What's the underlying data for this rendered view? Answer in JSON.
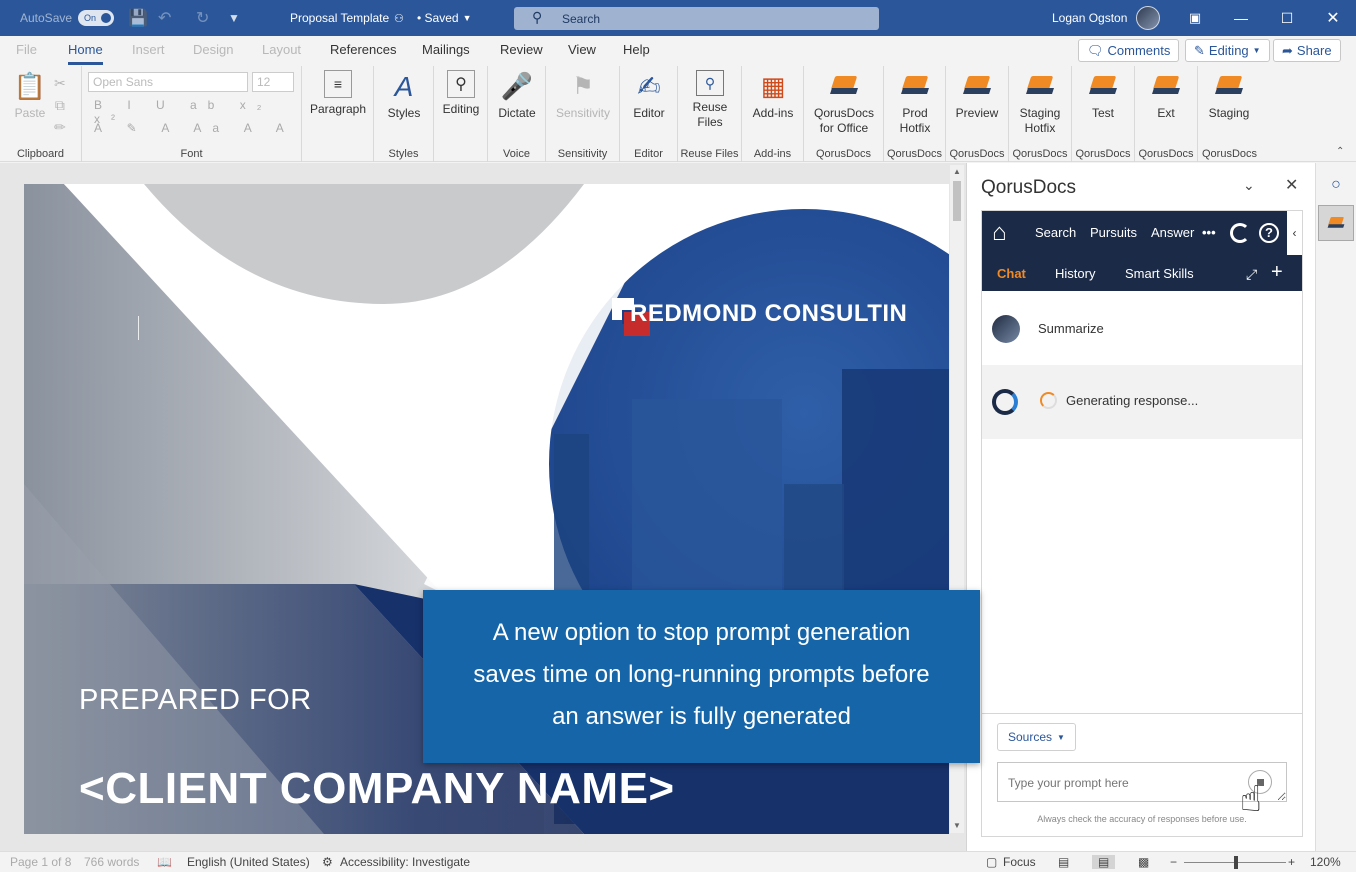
{
  "titlebar": {
    "autosave_label": "AutoSave",
    "autosave_state": "On",
    "doc_title": "Proposal Template",
    "saved_status": "• Saved",
    "search_placeholder": "Search",
    "user_name": "Logan Ogston"
  },
  "menu": {
    "tabs": [
      "File",
      "Home",
      "Insert",
      "Design",
      "Layout",
      "References",
      "Mailings",
      "Review",
      "View",
      "Help"
    ],
    "comments_label": "Comments",
    "editing_label": "Editing",
    "share_label": "Share"
  },
  "ribbon": {
    "clipboard_label": "Clipboard",
    "paste_label": "Paste",
    "font_name": "Open Sans",
    "font_size": "12",
    "font_group_label": "Font",
    "paragraph_label": "Paragraph",
    "styles_label": "Styles",
    "styles_group_label": "Styles",
    "editing_label": "Editing",
    "dictate_label": "Dictate",
    "voice_group_label": "Voice",
    "sensitivity_label": "Sensitivity",
    "sensitivity_group_label": "Sensitivity",
    "editor_label": "Editor",
    "editor_group_label": "Editor",
    "reuse_files_label_1": "Reuse",
    "reuse_files_label_2": "Files",
    "reuse_files_group_label": "Reuse Files",
    "addins_label": "Add-ins",
    "addins_group_label": "Add-ins",
    "qorus_buttons": [
      {
        "line1": "QorusDocs",
        "line2": "for Office",
        "group": "QorusDocs"
      },
      {
        "line1": "Prod",
        "line2": "Hotfix",
        "group": "QorusDocs"
      },
      {
        "line1": "Preview",
        "line2": "",
        "group": "QorusDocs"
      },
      {
        "line1": "Staging",
        "line2": "Hotfix",
        "group": "QorusDocs"
      },
      {
        "line1": "Test",
        "line2": "",
        "group": "QorusDocs"
      },
      {
        "line1": "Ext",
        "line2": "",
        "group": "QorusDocs"
      },
      {
        "line1": "Staging",
        "line2": "",
        "group": "QorusDocs"
      }
    ]
  },
  "document": {
    "logo_text": "REDMOND CONSULTIN",
    "prepared_for": "PREPARED FOR",
    "client_name": "<CLIENT COMPANY NAME>"
  },
  "callout": {
    "line1": "A new option to stop prompt generation",
    "line2": "saves time on long-running prompts before",
    "line3": "an answer is fully generated"
  },
  "pane": {
    "title": "QorusDocs",
    "nav": [
      "Search",
      "Pursuits",
      "Answer"
    ],
    "subtabs": [
      "Chat",
      "History",
      "Smart Skills"
    ],
    "user_message": "Summarize",
    "bot_status": "Generating response...",
    "sources_label": "Sources",
    "prompt_placeholder": "Type your prompt here",
    "disclaimer": "Always check the accuracy of responses before use."
  },
  "status": {
    "page": "Page 1 of 8",
    "words": "766 words",
    "language": "English (United States)",
    "accessibility": "Accessibility: Investigate",
    "focus": "Focus",
    "zoom": "120%"
  },
  "colors": {
    "word_blue": "#2b579a",
    "qorus_navy": "#1b2a47",
    "qorus_orange": "#f08a24",
    "callout_blue": "#1565a8"
  }
}
